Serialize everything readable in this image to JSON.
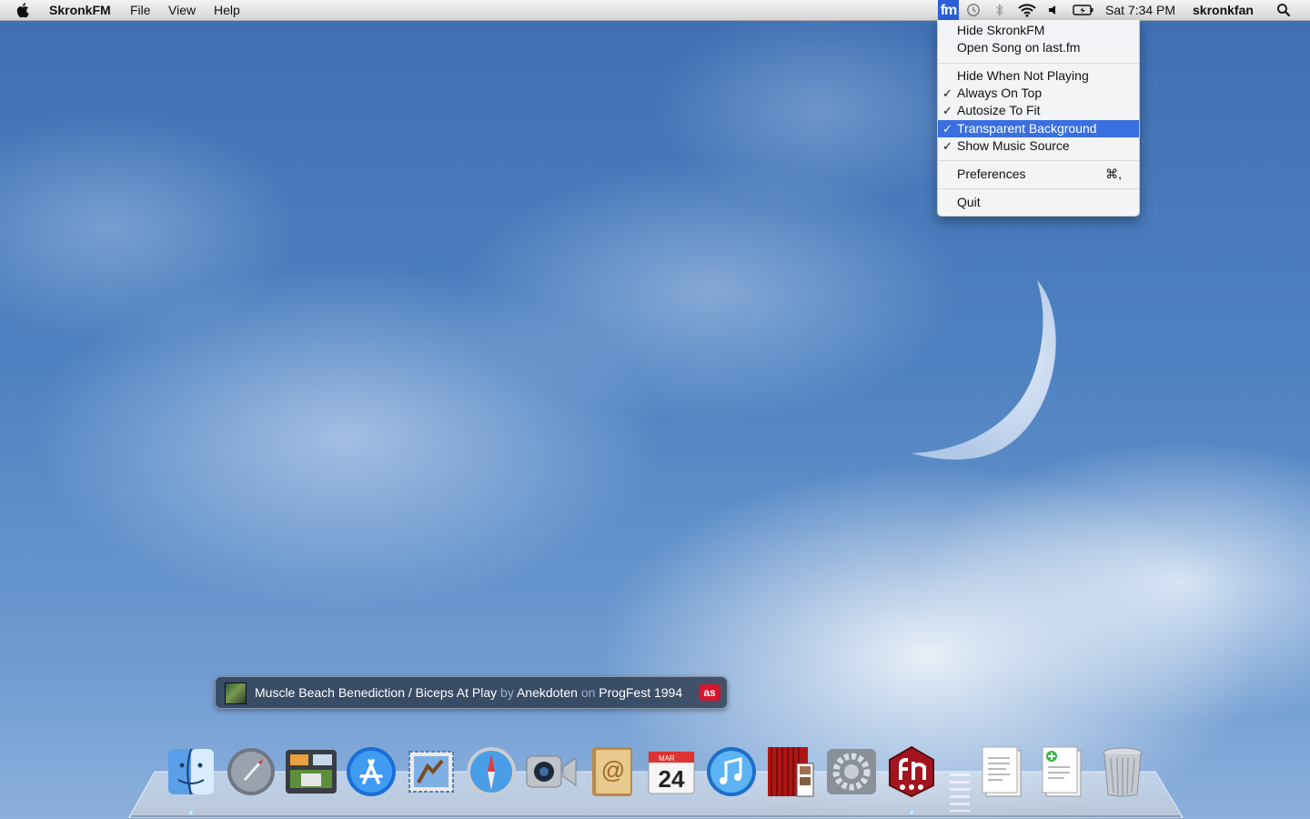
{
  "menubar": {
    "app_name": "SkronkFM",
    "menus": [
      "File",
      "View",
      "Help"
    ],
    "status_app_glyph": "fm",
    "clock": "Sat 7:34 PM",
    "user": "skronkfan",
    "status_icons": [
      "time-machine-icon",
      "bluetooth-icon",
      "wifi-icon",
      "volume-icon",
      "battery-icon"
    ]
  },
  "dropdown": {
    "items": [
      {
        "label": "Hide SkronkFM",
        "checked": false
      },
      {
        "label": "Open Song on last.fm",
        "checked": false
      },
      {
        "label": "Hide When Not Playing",
        "checked": false
      },
      {
        "label": "Always On Top",
        "checked": true
      },
      {
        "label": "Autosize To Fit",
        "checked": true
      },
      {
        "label": "Transparent Background",
        "checked": true,
        "highlighted": true
      },
      {
        "label": "Show Music Source",
        "checked": true
      },
      {
        "label": "Preferences",
        "shortcut": "⌘,"
      },
      {
        "label": "Quit"
      }
    ],
    "check_mark": "✓"
  },
  "now_playing": {
    "track": "Muscle Beach Benediction / Biceps At Play",
    "by": "by",
    "artist": "Anekdoten",
    "on": "on",
    "album": "ProgFest 1994",
    "source_badge": "as"
  },
  "dock": {
    "apps": [
      {
        "name": "Finder",
        "icon": "finder-icon",
        "running": true
      },
      {
        "name": "Launchpad",
        "icon": "launchpad-icon",
        "running": false
      },
      {
        "name": "Mission Control",
        "icon": "mission-control-icon",
        "running": false
      },
      {
        "name": "App Store",
        "icon": "app-store-icon",
        "running": false
      },
      {
        "name": "Mail",
        "icon": "mail-icon",
        "running": false
      },
      {
        "name": "Safari",
        "icon": "safari-icon",
        "running": false
      },
      {
        "name": "FaceTime",
        "icon": "facetime-icon",
        "running": false
      },
      {
        "name": "Address Book",
        "icon": "address-book-icon",
        "running": false
      },
      {
        "name": "iCal",
        "icon": "calendar-icon",
        "running": false,
        "month": "MAR",
        "day": "24"
      },
      {
        "name": "iTunes",
        "icon": "itunes-icon",
        "running": false
      },
      {
        "name": "Photo Booth",
        "icon": "photo-booth-icon",
        "running": false
      },
      {
        "name": "System Preferences",
        "icon": "system-preferences-icon",
        "running": false
      },
      {
        "name": "SkronkFM",
        "icon": "skronkfm-icon",
        "running": true
      },
      {
        "name": "Documents",
        "icon": "document-stack-icon",
        "running": false
      },
      {
        "name": "Downloads",
        "icon": "downloads-stack-icon",
        "running": false
      },
      {
        "name": "Trash",
        "icon": "trash-icon",
        "running": false
      }
    ]
  },
  "colors": {
    "menu_highlight": "#3a6fe0",
    "status_app_bg": "#2b5fd9",
    "lastfm_red": "#d4172c"
  }
}
